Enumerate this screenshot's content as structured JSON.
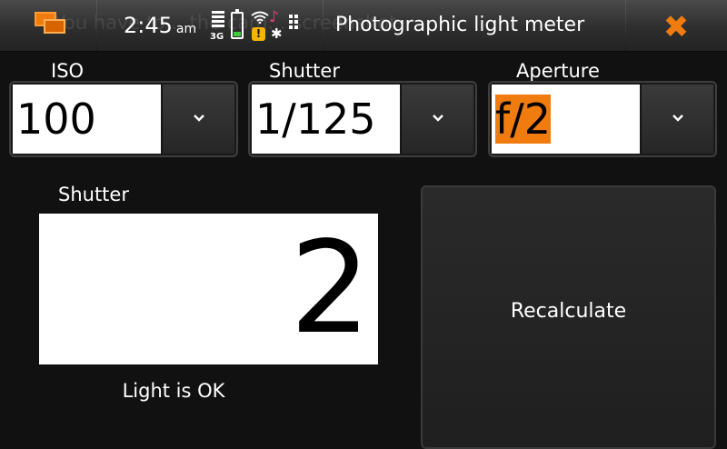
{
  "status_bar": {
    "ghost_text": "You have to... the cam... screenshot",
    "time": "2:45",
    "ampm": "am",
    "network": "3G",
    "title": "Photographic light meter",
    "icons": {
      "task_switcher": "task-switcher-icon",
      "signal": "signal-strength-icon",
      "battery": "battery-icon",
      "wifi": "wifi-icon",
      "warning": "warning-icon",
      "media": "music-note-icon",
      "bluetooth": "bluetooth-icon",
      "presence": "presence-icon",
      "close": "close-icon"
    },
    "accent_color": "#f07c10"
  },
  "selectors": {
    "iso": {
      "label": "ISO",
      "value": "100"
    },
    "shutter": {
      "label": "Shutter",
      "value": "1/125"
    },
    "aperture": {
      "label": "Aperture",
      "value": "f/2"
    }
  },
  "result": {
    "label": "Shutter",
    "value": "2",
    "status": "Light is OK"
  },
  "recalculate": {
    "label": "Recalculate"
  }
}
